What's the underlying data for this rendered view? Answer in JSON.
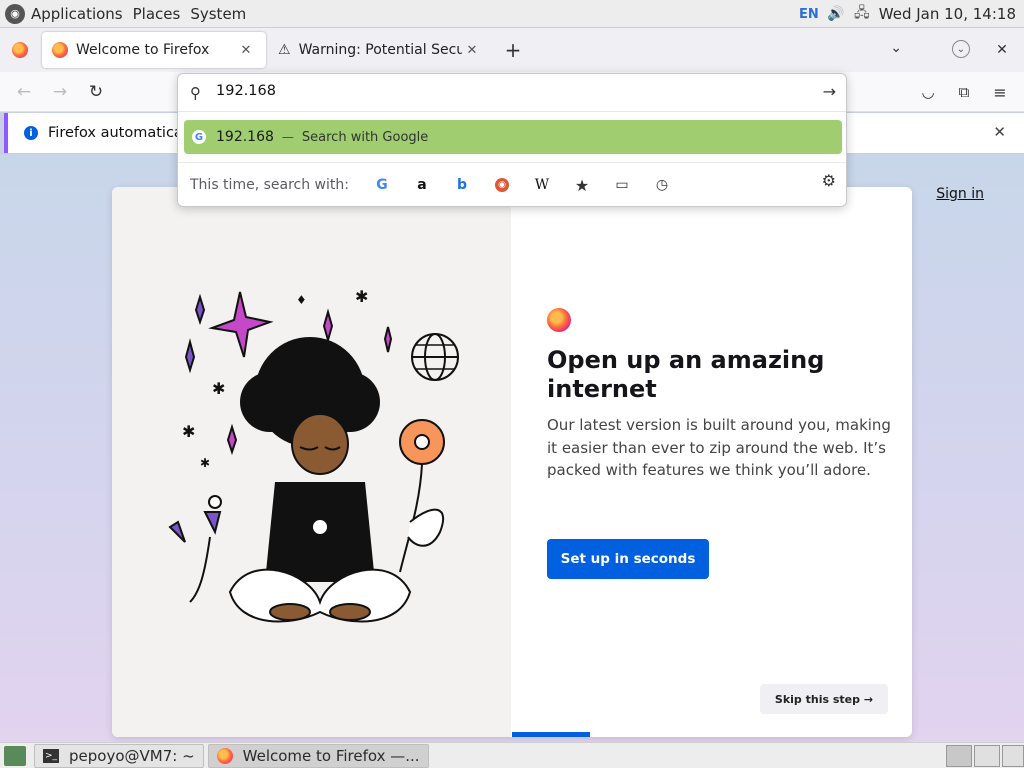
{
  "top_panel": {
    "menus": [
      "Applications",
      "Places",
      "System"
    ],
    "keyboard_layout": "EN",
    "clock": "Wed Jan 10, 14:18"
  },
  "tabs": [
    {
      "title": "Welcome to Firefox",
      "icon": "firefox-icon",
      "active": true
    },
    {
      "title": "Warning: Potential Securi",
      "icon": "warning-icon",
      "active": false
    }
  ],
  "urlbar": {
    "value": "192.168",
    "suggestion": {
      "text": "192.168",
      "separator": "—",
      "action": "Search with Google"
    },
    "search_with_label": "This time, search with:",
    "engines": [
      "google-icon",
      "amazon-icon",
      "bing-icon",
      "duckduckgo-icon",
      "wikipedia-icon",
      "bookmarks-star-icon",
      "tabs-icon",
      "history-clock-icon"
    ]
  },
  "notification": {
    "text": "Firefox automatically"
  },
  "page": {
    "sign_in": "Sign in",
    "title": "Open up an amazing internet",
    "body": "Our latest version is built around you, making it easier than ever to zip around the web. It’s packed with features we think you’ll adore.",
    "primary_button": "Set up in seconds",
    "skip_button": "Skip this step →"
  },
  "taskbar": {
    "tasks": [
      {
        "label": "pepoyo@VM7: ~",
        "icon": "terminal-icon"
      },
      {
        "label": "Welcome to Firefox —...",
        "icon": "firefox-icon"
      }
    ]
  },
  "colors": {
    "accent_blue": "#0060df",
    "suggestion_highlight": "#9fcd6f",
    "notification_border": "#9059ff"
  }
}
